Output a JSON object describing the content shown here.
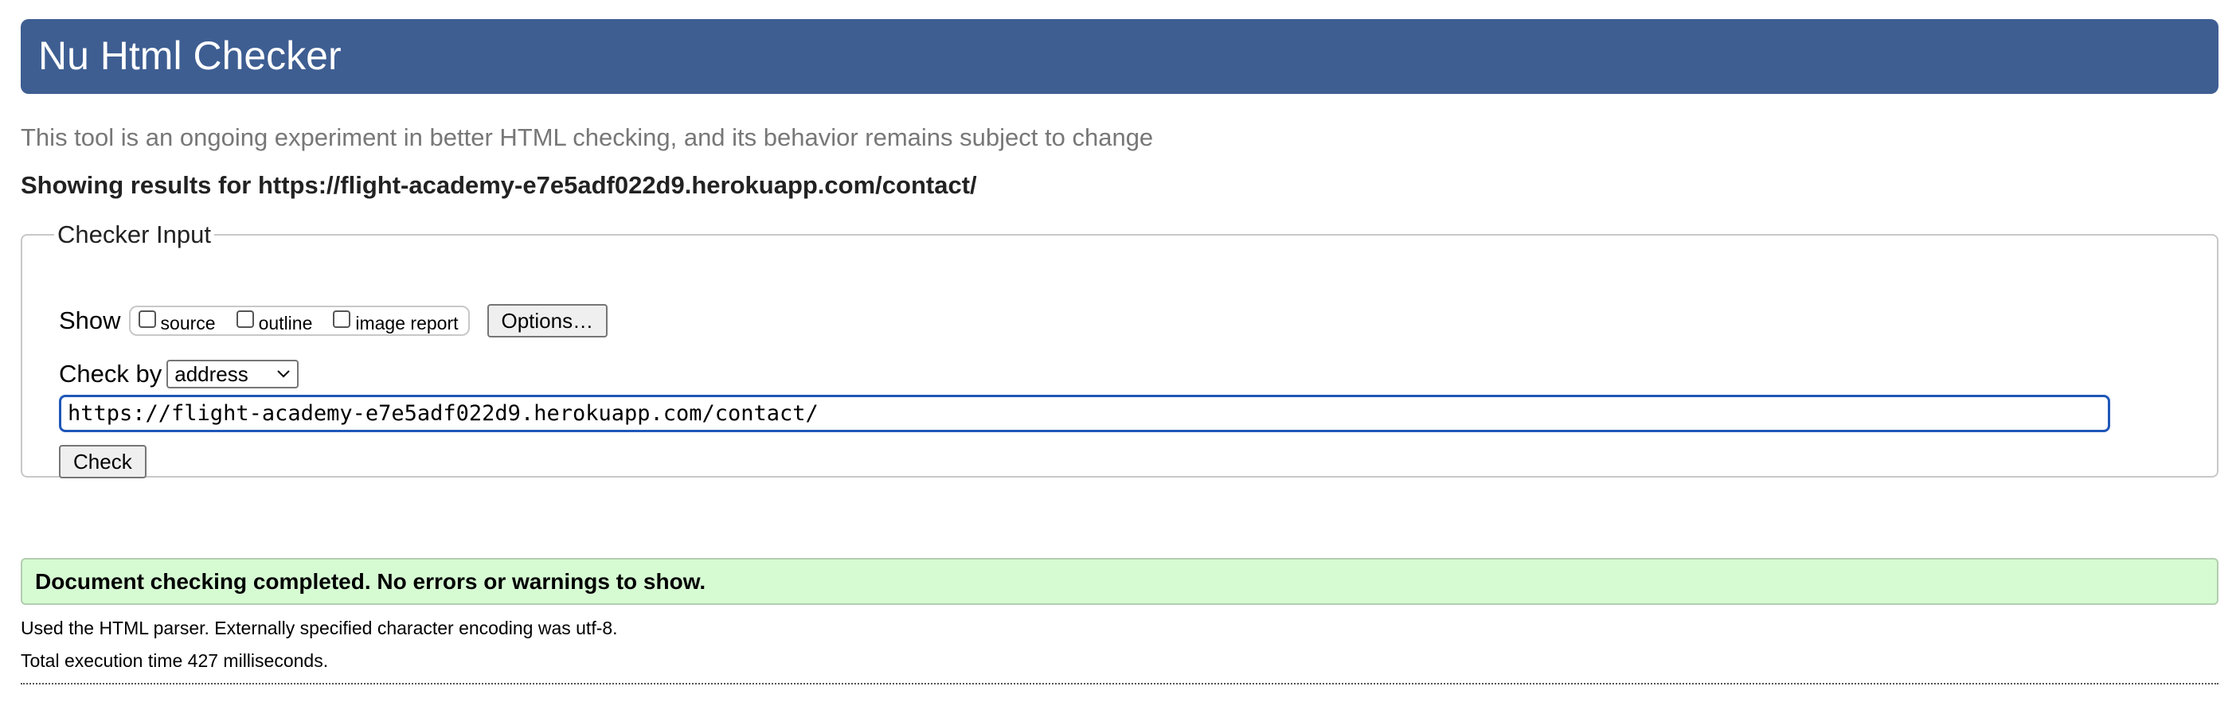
{
  "header": {
    "title": "Nu Html Checker"
  },
  "tagline": "This tool is an ongoing experiment in better HTML checking, and its behavior remains subject to change",
  "results_heading": "Showing results for https://flight-academy-e7e5adf022d9.herokuapp.com/contact/",
  "checker_input": {
    "legend": "Checker Input",
    "show_label": "Show",
    "show_options": [
      {
        "label": "source",
        "checked": false
      },
      {
        "label": "outline",
        "checked": false
      },
      {
        "label": "image report",
        "checked": false
      }
    ],
    "options_button": "Options…",
    "check_by_label": "Check by",
    "check_by_value": "address",
    "url_value": "https://flight-academy-e7e5adf022d9.herokuapp.com/contact/",
    "check_button": "Check"
  },
  "result": {
    "message": "Document checking completed. No errors or warnings to show.",
    "parser_info": "Used the HTML parser. Externally specified character encoding was utf-8.",
    "execution_time": "Total execution time 427 milliseconds."
  },
  "colors": {
    "header_bg": "#3e5e92",
    "success_bg": "#d6fbd3",
    "input_focus_border": "#1f57b8"
  },
  "icons": {
    "select_chevron": "chevron-down-icon"
  }
}
